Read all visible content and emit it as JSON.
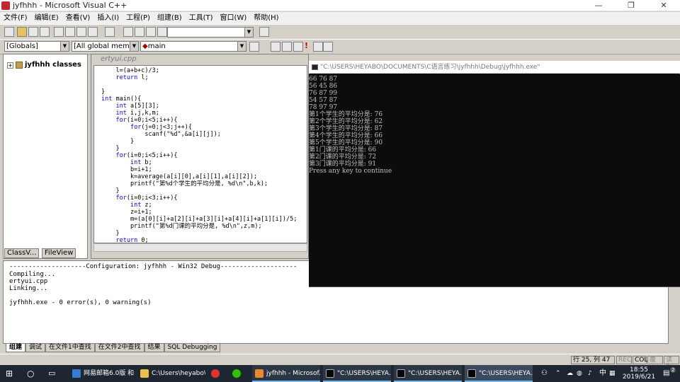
{
  "window": {
    "title": "jyfhhh - Microsoft Visual C++",
    "minimize": "—",
    "restore": "❐",
    "close": "✕"
  },
  "menu": [
    "文件(F)",
    "编辑(E)",
    "查看(V)",
    "插入(I)",
    "工程(P)",
    "组建(B)",
    "工具(T)",
    "窗口(W)",
    "帮助(H)"
  ],
  "toolbar2": {
    "globals": "[Globals]",
    "members": "[All global members",
    "function": "main"
  },
  "workspace": {
    "tree_root": "jyfhhh classes",
    "tabs": [
      "ClassV...",
      "FileView"
    ]
  },
  "editor": {
    "file_tab": "ertyui.cpp",
    "code": [
      "    l=(a+b+c)/3;",
      "    return l;",
      "",
      "}",
      "int main(){",
      "    int a[5][3];",
      "    int i,j,k,m;",
      "    for(i=0;i<5;i++){",
      "        for(j=0;j<3;j++){",
      "            scanf(\"%d\",&a[i][j]);",
      "        }",
      "    }",
      "    for(i=0;i<5;i++){",
      "        int b;",
      "        b=i+1;",
      "        k=average(a[i][0],a[i][1],a[i][2]);",
      "        printf(\"第%d个学生的平均分是, %d\\n\",b,k);",
      "    }",
      "    for(i=0;i<3;i++){",
      "        int z;",
      "        z=i+1;",
      "        m=(a[0][i]+a[2][i]+a[3][i]+a[4][i]+a[1][i])/5;",
      "        printf(\"第%d门课的平均分是, %d\\n\",z,m);",
      "    }",
      "    return 0;"
    ]
  },
  "output": {
    "lines": [
      "--------------------Configuration: jyfhhh - Win32 Debug--------------------",
      "Compiling...",
      "ertyui.cpp",
      "Linking...",
      "",
      "jyfhhh.exe - 0 error(s), 0 warning(s)"
    ],
    "tabs": [
      "组建",
      "调试",
      "在文件1中查找",
      "在文件2中查找",
      "结果",
      "SQL Debugging"
    ]
  },
  "status": {
    "position": "行 25, 列 47",
    "rec": "REC",
    "col": "COL",
    "ovr": "覆盖",
    "read": "读取"
  },
  "console": {
    "title": "\"C:\\USERS\\HEYABO\\DOCUMENTS\\C语言练习\\jyfhhh\\Debug\\jyfhhh.exe\"",
    "lines": [
      "66 76 87",
      "56 45 86",
      "76 87 99",
      "54 57 87",
      "78 97 97",
      "第1个学生的平均分是: 76",
      "第2个学生的平均分是: 62",
      "第3个学生的平均分是: 87",
      "第4个学生的平均分是: 66",
      "第5个学生的平均分是: 90",
      "第1门课的平均分是: 66",
      "第2门课的平均分是: 72",
      "第3门课的平均分是: 91",
      "Press any key to continue"
    ]
  },
  "taskbar": {
    "items": [
      "网易邮箱6.0版 和 ...",
      "C:\\Users\\heyabo\\...",
      "jyfhhh - Microsof...",
      "\"C:\\USERS\\HEYA...",
      "\"C:\\USERS\\HEYA...",
      "\"C:\\USERS\\HEYA..."
    ],
    "time": "18:55",
    "date": "2019/6/21",
    "ime": "中",
    "notify_count": "2"
  }
}
